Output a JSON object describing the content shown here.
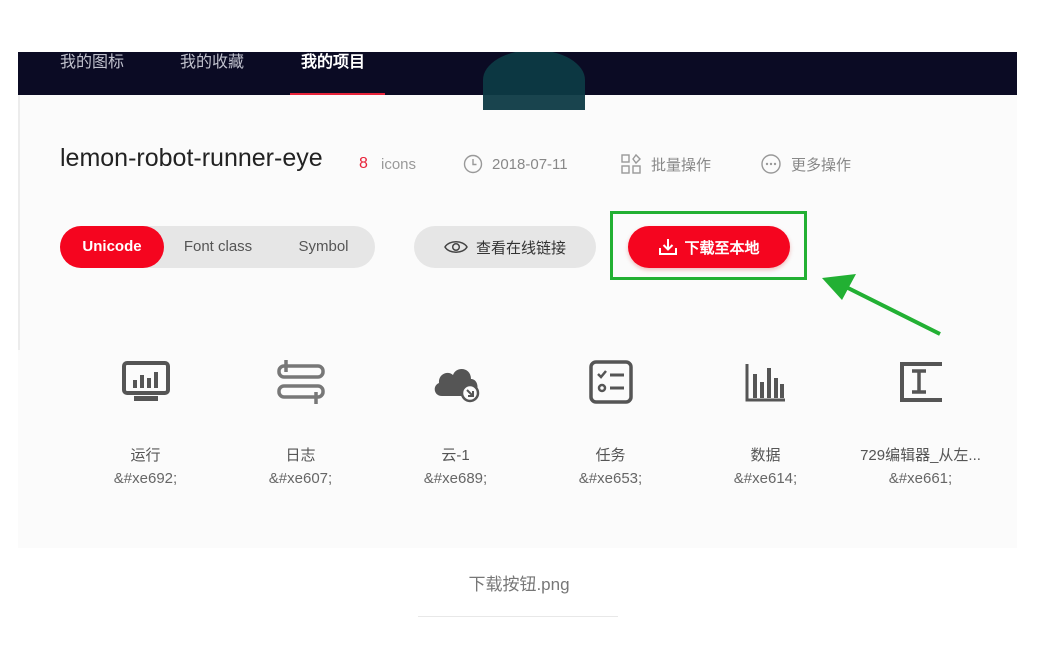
{
  "nav": {
    "tabs": [
      {
        "label": "我的图标"
      },
      {
        "label": "我的收藏"
      },
      {
        "label": "我的项目"
      }
    ],
    "active_index": 2
  },
  "project": {
    "title": "lemon-robot-runner-eye",
    "count": "8",
    "count_label": "icons",
    "date": "2018-07-11",
    "batch_label": "批量操作",
    "more_label": "更多操作"
  },
  "toolbar": {
    "segments": [
      {
        "label": "Unicode"
      },
      {
        "label": "Font class"
      },
      {
        "label": "Symbol"
      }
    ],
    "active_segment": 0,
    "online_link_label": "查看在线链接",
    "download_label": "下载至本地"
  },
  "icons": [
    {
      "name": "运行",
      "code": "&#xe692;",
      "icon": "monitor-chart-icon"
    },
    {
      "name": "日志",
      "code": "&#xe607;",
      "icon": "log-arrows-icon"
    },
    {
      "name": "云-1",
      "code": "&#xe689;",
      "icon": "cloud-icon"
    },
    {
      "name": "任务",
      "code": "&#xe653;",
      "icon": "task-checklist-icon"
    },
    {
      "name": "数据",
      "code": "&#xe614;",
      "icon": "bar-chart-icon"
    },
    {
      "name": "729编辑器_从左...",
      "code": "&#xe661;",
      "icon": "editor-align-icon"
    }
  ],
  "caption": "下载按钮.png",
  "colors": {
    "nav_bg": "#0b0b24",
    "accent_red": "#f5051f",
    "highlight_green": "#22b033"
  }
}
